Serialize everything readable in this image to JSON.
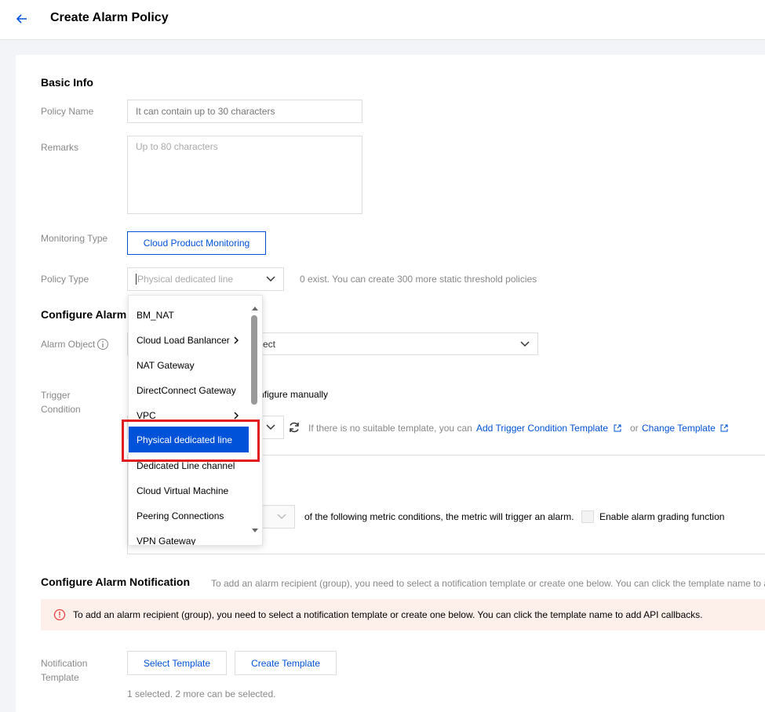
{
  "header": {
    "title": "Create Alarm Policy"
  },
  "basic_info": {
    "section_title": "Basic Info",
    "policy_name_label": "Policy Name",
    "policy_name_placeholder": "It can contain up to 30 characters",
    "remarks_label": "Remarks",
    "remarks_placeholder": "Up to 80 characters",
    "monitoring_type_label": "Monitoring Type",
    "monitoring_type_value": "Cloud Product Monitoring",
    "policy_type_label": "Policy Type",
    "policy_type_placeholder": "Physical dedicated line",
    "policy_type_hint": "0 exist. You can create 300 more static threshold policies"
  },
  "configure_alarm": {
    "section_title": "Configure Alarm",
    "alarm_object_label": "Alarm Object",
    "alarm_object_value_fragment": "ect",
    "trigger_label_line1": "Trigger",
    "trigger_label_line2": "Condition",
    "configure_manually_fragment": "nfigure manually",
    "template_hint": "If there is no suitable template, you can",
    "add_template_link": "Add Trigger Condition Template",
    "or_text": "or",
    "change_template_link": "Change Template",
    "metric_condition_text": "of the following metric conditions, the metric will trigger an alarm.",
    "enable_grading_label": "Enable alarm grading function"
  },
  "dropdown": {
    "items": [
      {
        "label": "BM_NAT",
        "has_children": false
      },
      {
        "label": "Cloud Load Banlancer",
        "has_children": true
      },
      {
        "label": "NAT Gateway",
        "has_children": false
      },
      {
        "label": "DirectConnect Gateway",
        "has_children": false
      },
      {
        "label": "VPC",
        "has_children": true
      },
      {
        "label": "Physical dedicated line",
        "has_children": false,
        "selected": true
      },
      {
        "label": "Dedicated Line channel",
        "has_children": false
      },
      {
        "label": "Cloud Virtual Machine",
        "has_children": false
      },
      {
        "label": "Peering Connections",
        "has_children": false
      },
      {
        "label": "VPN Gateway",
        "has_children": false
      }
    ]
  },
  "notification": {
    "section_title": "Configure Alarm Notification",
    "section_hint": "To add an alarm recipient (group), you need to select a notification template or create one below. You can click the template name to a",
    "info_text": "To add an alarm recipient (group), you need to select a notification template or create one below. You can click the template name to add API callbacks.",
    "template_label_line1": "Notification",
    "template_label_line2": "Template",
    "select_template": "Select Template",
    "create_template": "Create Template",
    "selected_count": "1 selected. 2 more can be selected."
  },
  "colors": {
    "brand": "#0052d9",
    "highlight": "#e11b22",
    "info_bg": "#fdf0ea",
    "warning": "#e54545"
  }
}
